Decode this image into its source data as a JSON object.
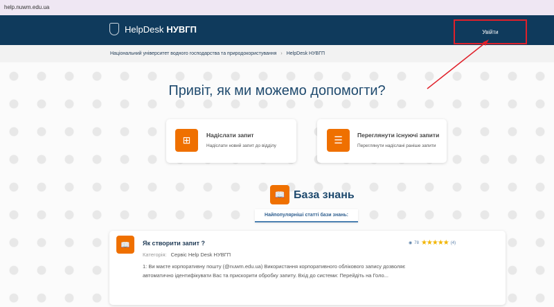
{
  "browser": {
    "url": "help.nuwm.edu.ua"
  },
  "header": {
    "brand": "HelpDesk",
    "brand_bold": "НУВГП",
    "login": "Увійти"
  },
  "breadcrumb": [
    "Національний університет водного господарства та природокористування",
    "HelpDesk НУВГП"
  ],
  "breadcrumb_sep": "›",
  "hero": {
    "title": "Привіт, як ми можемо допомогти?"
  },
  "actions": [
    {
      "title": "Надіслати запит",
      "subtitle": "Надіслати новий запит до відділу",
      "icon": "file-plus-icon"
    },
    {
      "title": "Переглянути існуючі запити",
      "subtitle": "Переглянути надіслані раніше запити",
      "icon": "file-text-icon"
    }
  ],
  "kb": {
    "title": "База знань",
    "popular_label": "Найпопулярніші статті бази знань:"
  },
  "article": {
    "title": "Як створити запит ?",
    "category_label": "Категорія:",
    "category": "Сервіс Help Desk НУВГП",
    "excerpt": "1: Ви маєте корпоративну пошту (@nuwm.edu.ua) Використання корпоративного облікового запису дозволяє автоматично ідентифікувати Вас та прискорити обробку запиту. Вхід до системи: Перейдіть на Голо...",
    "views": "78",
    "rating": 5,
    "stars": "★★★★★",
    "votes": "(4)"
  },
  "colors": {
    "header": "#0f3a5c",
    "accent": "#ef7000",
    "annotation": "#e0202a"
  }
}
